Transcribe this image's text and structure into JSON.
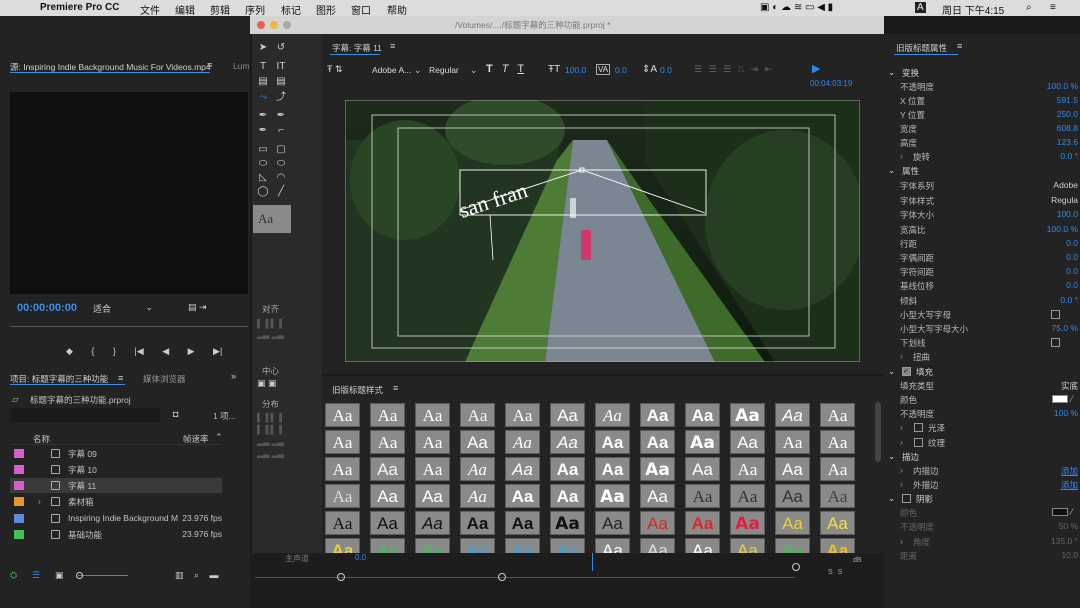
{
  "menubar": {
    "app": "Premiere Pro CC",
    "items": [
      "文件",
      "编辑",
      "剪辑",
      "序列",
      "标记",
      "图形",
      "窗口",
      "帮助"
    ],
    "clock": "周日 下午4:15",
    "battery_icon": "battery-icon",
    "wifi_icon": "wifi-icon"
  },
  "window": {
    "path": "/Volumes/..../标题字幕的三种功能.prproj *"
  },
  "source": {
    "tab": "源: Inspiring Indie Background Music For Videos.mp4",
    "tab2": "Lum",
    "timecode": "00:00:00:00",
    "fit": "适合"
  },
  "project": {
    "tab": "项目: 标题字幕的三种功能",
    "tab2": "媒体浏览器",
    "file": "标题字幕的三种功能.prproj",
    "count": "1 项...",
    "col_name": "名称",
    "col_rate": "帧速率",
    "items": [
      {
        "name": "字幕 09",
        "fps": "",
        "color": "#d65fd0"
      },
      {
        "name": "字幕 10",
        "fps": "",
        "color": "#d65fd0"
      },
      {
        "name": "字幕 11",
        "fps": "",
        "color": "#d65fd0"
      },
      {
        "name": "素材箱",
        "fps": "",
        "color": "#e5962f"
      },
      {
        "name": "Inspiring Indie Background M",
        "fps": "23.976 fps",
        "color": "#5c8bdc"
      },
      {
        "name": "基础功能",
        "fps": "23.976 fps",
        "color": "#3ec252"
      }
    ]
  },
  "tools": {
    "align": "对齐",
    "center": "中心",
    "distribute": "分布",
    "aa": "Aa"
  },
  "title_panel": {
    "tab": "字幕: 字幕 11",
    "font": "Adobe A...",
    "style": "Regular",
    "size": "100.0",
    "kerning": "0.0",
    "leading": "0.0",
    "timecode": "00:04:03:19",
    "text": "san fran"
  },
  "styles": {
    "tab": "旧版标题样式",
    "label": "Aa"
  },
  "props": {
    "tab": "旧版标题属性",
    "transform": "变换",
    "opacity": "不透明度",
    "opacity_v": "100.0 %",
    "x": "X 位置",
    "x_v": "591.5",
    "y": "Y 位置",
    "y_v": "250.0",
    "w": "宽度",
    "w_v": "608.8",
    "h": "高度",
    "h_v": "123.6",
    "rot": "旋转",
    "rot_v": "0.0 °",
    "attr": "属性",
    "font_family": "字体系列",
    "font_family_v": "Adobe",
    "font_style": "字体样式",
    "font_style_v": "Regula",
    "font_size": "字体大小",
    "font_size_v": "100.0",
    "aspect": "宽高比",
    "aspect_v": "100.0 %",
    "leading": "行距",
    "leading_v": "0.0",
    "kerning": "字偶间距",
    "kerning_v": "0.0",
    "tracking": "字符间距",
    "tracking_v": "0.0",
    "baseline": "基线位移",
    "baseline_v": "0.0",
    "slant": "倾斜",
    "slant_v": "0.0 °",
    "smallcaps": "小型大写字母",
    "smallcaps_size": "小型大写字母大小",
    "smallcaps_size_v": "75.0 %",
    "underline": "下划线",
    "distort": "扭曲",
    "fill": "填充",
    "fill_type": "填充类型",
    "fill_type_v": "实底",
    "color": "颜色",
    "fill_opacity": "不透明度",
    "fill_opacity_v": "100 %",
    "sheen": "光泽",
    "texture": "纹理",
    "stroke": "描边",
    "inner": "内描边",
    "outer": "外描边",
    "add": "添加",
    "shadow": "阴影",
    "sh_color": "颜色",
    "sh_opacity": "不透明度",
    "sh_opacity_v": "50 %",
    "sh_angle": "角度",
    "sh_angle_v": "135.0 °",
    "sh_dist": "距离",
    "sh_dist_v": "10.0"
  },
  "timeline": {
    "label": "主声道",
    "val": "0.0",
    "db": "dB",
    "s": "S"
  }
}
